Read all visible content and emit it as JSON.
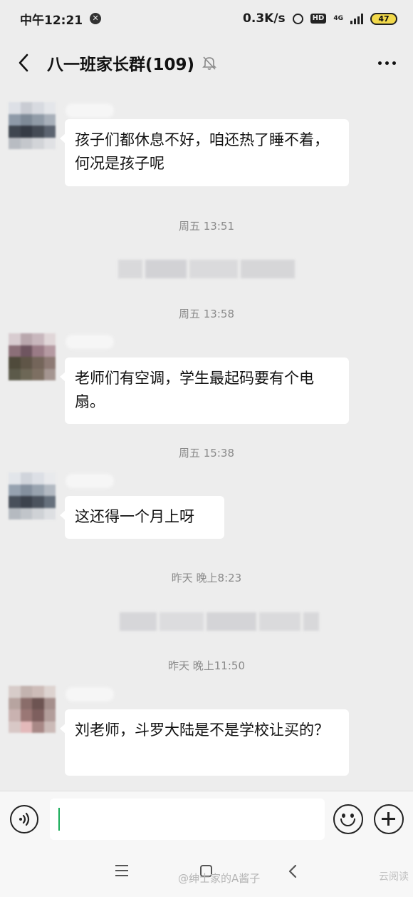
{
  "status_bar": {
    "time": "中午12:21",
    "network_speed": "0.3K/s",
    "hd_label": "HD",
    "network_type": "4G",
    "battery": "47"
  },
  "header": {
    "title": "八一班家长群(109)"
  },
  "messages": [
    {
      "text": "孩子们都休息不好，咱还热了睡不着，何况是孩子呢"
    },
    {
      "text": "老师们有空调，学生最起码要有个电扇。"
    },
    {
      "text": "这还得一个月上呀"
    },
    {
      "text": "刘老师，斗罗大陆是不是学校让买的？"
    }
  ],
  "timestamps": [
    "周五 13:51",
    "周五 13:58",
    "周五 15:38",
    "昨天 晚上8:23",
    "昨天 晚上11:50"
  ],
  "input": {
    "value": ""
  },
  "watermark": {
    "text": "@绅士家的A酱子",
    "corner": "云阅读"
  },
  "colors": {
    "background": "#ededed",
    "bubble": "#ffffff",
    "caret": "#1aad5a",
    "timestamp": "#8a8a8a"
  },
  "icons": {
    "back": "chevron-left-icon",
    "mute": "bell-off-icon",
    "more": "more-dots-icon",
    "voice": "voice-icon",
    "emoji": "smile-icon",
    "plus": "plus-icon"
  }
}
